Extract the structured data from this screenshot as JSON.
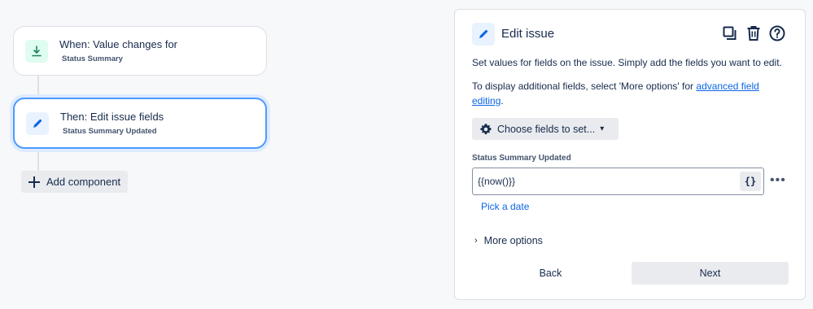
{
  "flow": {
    "trigger": {
      "title": "When: Value changes for",
      "subtitle": "Status Summary",
      "icon": "download-arrow-icon"
    },
    "action": {
      "title": "Then: Edit issue fields",
      "subtitle": "Status Summary Updated",
      "icon": "pencil-icon"
    },
    "add_component_label": "Add component"
  },
  "panel": {
    "title": "Edit issue",
    "tools": [
      "copy-icon",
      "trash-icon",
      "help-icon"
    ],
    "description": "Set values for fields on the issue. Simply add the fields you want to edit.",
    "additional_text": "To display additional fields, select 'More options' for ",
    "additional_link": "advanced field editing",
    "additional_end": ".",
    "choose_fields_label": "Choose fields to set...",
    "field_label": "Status Summary Updated",
    "field_value": "{{now()}}",
    "smart_value_button": "{}",
    "more_dots": "•••",
    "pick_date_label": "Pick a date",
    "more_options_label": "More options",
    "back_label": "Back",
    "next_label": "Next"
  },
  "colors": {
    "accent_blue": "#0c66e4",
    "focus_border": "#4c9aff",
    "trigger_icon_bg": "#dffcf0",
    "action_icon_bg": "#e9f2ff"
  }
}
